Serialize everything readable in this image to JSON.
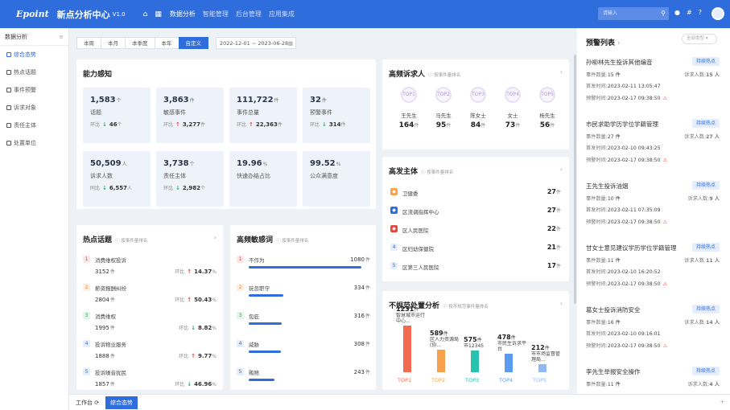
{
  "topbar": {
    "logo": "Epoint",
    "app_title": "新点分析中心",
    "version": "V1.0",
    "nav": [
      "数据分析",
      "智能管理",
      "后台管理",
      "应用集成"
    ],
    "search_placeholder": "请输入",
    "icons": [
      "home-icon",
      "grid-icon",
      "search-icon",
      "bell-icon",
      "hash-icon",
      "help-icon",
      "avatar"
    ]
  },
  "sidebar": {
    "header": "数据分析",
    "items": [
      "综合态势",
      "热点话题",
      "事件预警",
      "诉求对象",
      "责任主体",
      "处置单位"
    ],
    "active_index": 0
  },
  "filters": {
    "tabs": [
      "本周",
      "本月",
      "本季度",
      "本年",
      "自定义"
    ],
    "active_index": 4,
    "date_range": "2022-12-01 ~ 2023-06-28"
  },
  "ability": {
    "title": "能力感知",
    "metrics": [
      {
        "value": "1,583",
        "unit": "个",
        "label": "话题",
        "trend_label": "环比",
        "trend_value": "46",
        "trend_unit": "个",
        "dir": "down"
      },
      {
        "value": "3,863",
        "unit": "件",
        "label": "敏感事件",
        "trend_label": "环比",
        "trend_value": "3,277",
        "trend_unit": "件",
        "dir": "up"
      },
      {
        "value": "111,722",
        "unit": "件",
        "label": "事件总量",
        "trend_label": "环比",
        "trend_value": "22,363",
        "trend_unit": "件",
        "dir": "up"
      },
      {
        "value": "32",
        "unit": "件",
        "label": "预警事件",
        "trend_label": "环比",
        "trend_value": "314",
        "trend_unit": "件",
        "dir": "down"
      },
      {
        "value": "50,509",
        "unit": "人",
        "label": "诉求人数",
        "trend_label": "同比",
        "trend_value": "6,557",
        "trend_unit": "人",
        "dir": "down"
      },
      {
        "value": "3,738",
        "unit": "个",
        "label": "责任主体",
        "trend_label": "环比",
        "trend_value": "2,982",
        "trend_unit": "个",
        "dir": "down"
      },
      {
        "value": "19.96",
        "unit": "%",
        "label": "快速办结占比",
        "trend_label": "",
        "trend_value": "",
        "trend_unit": "",
        "dir": ""
      },
      {
        "value": "99.52",
        "unit": "%",
        "label": "公众满意度",
        "trend_label": "",
        "trend_value": "",
        "trend_unit": "",
        "dir": ""
      }
    ]
  },
  "hot_topics": {
    "title": "热点话题",
    "subtitle": "按事件量排名",
    "items": [
      {
        "rank": "1",
        "name": "消费维权投诉",
        "count": "3152",
        "unit": "件",
        "trend_label": "环比",
        "trend_value": "14.37",
        "dir": "up"
      },
      {
        "rank": "2",
        "name": "薪资报酬纠纷",
        "count": "2804",
        "unit": "件",
        "trend_label": "环比",
        "trend_value": "50.43",
        "dir": "up"
      },
      {
        "rank": "3",
        "name": "消费维权",
        "count": "1995",
        "unit": "件",
        "trend_label": "环比",
        "trend_value": "8.82",
        "dir": "down"
      },
      {
        "rank": "4",
        "name": "投诉物业服务",
        "count": "1888",
        "unit": "件",
        "trend_label": "环比",
        "trend_value": "9.77",
        "dir": "up"
      },
      {
        "rank": "5",
        "name": "投诉噪音扰民",
        "count": "1857",
        "unit": "件",
        "trend_label": "环比",
        "trend_value": "46.96",
        "dir": "down"
      }
    ]
  },
  "sensitive_words": {
    "title": "高频敏感词",
    "subtitle": "按事件量排名",
    "items": [
      {
        "rank": "1",
        "word": "不作为",
        "count": "1080",
        "unit": "件",
        "value": 1080
      },
      {
        "rank": "2",
        "word": "玩忽职守",
        "count": "334",
        "unit": "件",
        "value": 334
      },
      {
        "rank": "3",
        "word": "包庇",
        "count": "316",
        "unit": "件",
        "value": 316
      },
      {
        "rank": "4",
        "word": "威胁",
        "count": "308",
        "unit": "件",
        "value": 308
      },
      {
        "rank": "5",
        "word": "贿赂",
        "count": "243",
        "unit": "件",
        "value": 243
      }
    ]
  },
  "petitioners": {
    "title": "高频诉求人",
    "subtitle": "按事件量排名",
    "items": [
      {
        "name": "王先生",
        "count": "164",
        "unit": "件",
        "badge": "TOP1"
      },
      {
        "name": "马先生",
        "count": "95",
        "unit": "件",
        "badge": "TOP2"
      },
      {
        "name": "陈女士",
        "count": "84",
        "unit": "件",
        "badge": "TOP3"
      },
      {
        "name": "女士",
        "count": "73",
        "unit": "件",
        "badge": "TOP4"
      },
      {
        "name": "杨先生",
        "count": "56",
        "unit": "件",
        "badge": "TOP5"
      }
    ]
  },
  "subjects": {
    "title": "高发主体",
    "subtitle": "按事件量排名",
    "items": [
      {
        "rank": "1",
        "name": "卫健委",
        "count": "27",
        "unit": "件"
      },
      {
        "rank": "2",
        "name": "区流调指挥中心",
        "count": "27",
        "unit": "件"
      },
      {
        "rank": "3",
        "name": "区人民医院",
        "count": "22",
        "unit": "件"
      },
      {
        "rank": "4",
        "name": "区妇幼保健院",
        "count": "21",
        "unit": "件"
      },
      {
        "rank": "5",
        "name": "区第三人民医院",
        "count": "17",
        "unit": "件"
      }
    ]
  },
  "irregular": {
    "title": "不规范处置分析",
    "subtitle": "按不规范事件量排名",
    "items": [
      {
        "value": "1231",
        "unit": "件",
        "name": "智慧城市运行中心...",
        "label": "TOP1",
        "n": 1231
      },
      {
        "value": "589",
        "unit": "件",
        "name": "区人力资源局(协...",
        "label": "TOP2",
        "n": 589
      },
      {
        "value": "575",
        "unit": "件",
        "name": "市12345",
        "label": "TOP3",
        "n": 575
      },
      {
        "value": "478",
        "unit": "件",
        "name": "市民生诉求平台",
        "label": "TOP4",
        "n": 478
      },
      {
        "value": "212",
        "unit": "件",
        "name": "市市场监督管理局...",
        "label": "TOP5",
        "n": 212
      }
    ]
  },
  "alerts": {
    "title": "预警列表",
    "select_placeholder": "全部类型",
    "items": [
      {
        "title": "孙柳林先生投诉其他编音",
        "badge": "持续热点",
        "count_label": "事件数量:",
        "count": "15 件",
        "people_label": "诉求人数:",
        "people": "15 人",
        "first_label": "首发时间:",
        "first": "2023-02-11 13:05:47",
        "warn_label": "预警时间:",
        "warn": "2023-02-17 09:38:50"
      },
      {
        "title": "市民求助学历学位学籍管理",
        "badge": "持续热点",
        "count_label": "事件数量:",
        "count": "27 件",
        "people_label": "诉求人数:",
        "people": "27 人",
        "first_label": "首发时间:",
        "first": "2023-02-10 09:43:25",
        "warn_label": "预警时间:",
        "warn": "2023-02-17 09:38:50"
      },
      {
        "title": "王先生投诉油烟",
        "badge": "持续热点",
        "count_label": "事件数量:",
        "count": "10 件",
        "people_label": "诉求人数:",
        "people": "9 人",
        "first_label": "首发时间:",
        "first": "2023-02-11 07:35:09",
        "warn_label": "预警时间:",
        "warn": "2023-02-17 09:38:50"
      },
      {
        "title": "甘女士意见建议学历学位学籍管理",
        "badge": "持续热点",
        "count_label": "事件数量:",
        "count": "11 件",
        "people_label": "诉求人数:",
        "people": "11 人",
        "first_label": "首发时间:",
        "first": "2023-02-10 16:20:52",
        "warn_label": "预警时间:",
        "warn": "2023-02-17 09:38:50"
      },
      {
        "title": "葛女士投诉消防安全",
        "badge": "持续热点",
        "count_label": "事件数量:",
        "count": "16 件",
        "people_label": "诉求人数:",
        "people": "14 人",
        "first_label": "首发时间:",
        "first": "2023-02-10 09:16:01",
        "warn_label": "预警时间:",
        "warn": "2023-02-17 09:38:50"
      },
      {
        "title": "李先生举报安全操作",
        "badge": "持续热点",
        "count_label": "事件数量:",
        "count": "11 件",
        "people_label": "诉求人数:",
        "people": "4 人",
        "first_label": "",
        "first": "",
        "warn_label": "",
        "warn": ""
      }
    ]
  },
  "bottom_tabs": [
    "工作台",
    "综合态势"
  ],
  "colors": {
    "primary": "#2f6cdc",
    "up": "#e5483f",
    "down": "#23ad5c",
    "bar_top1": "#f26b50",
    "bar_top2": "#f7a24b",
    "bar_top3": "#27c2b0",
    "bar_top4": "#5b9cf0",
    "bar_top5": "#8fb8f5"
  }
}
